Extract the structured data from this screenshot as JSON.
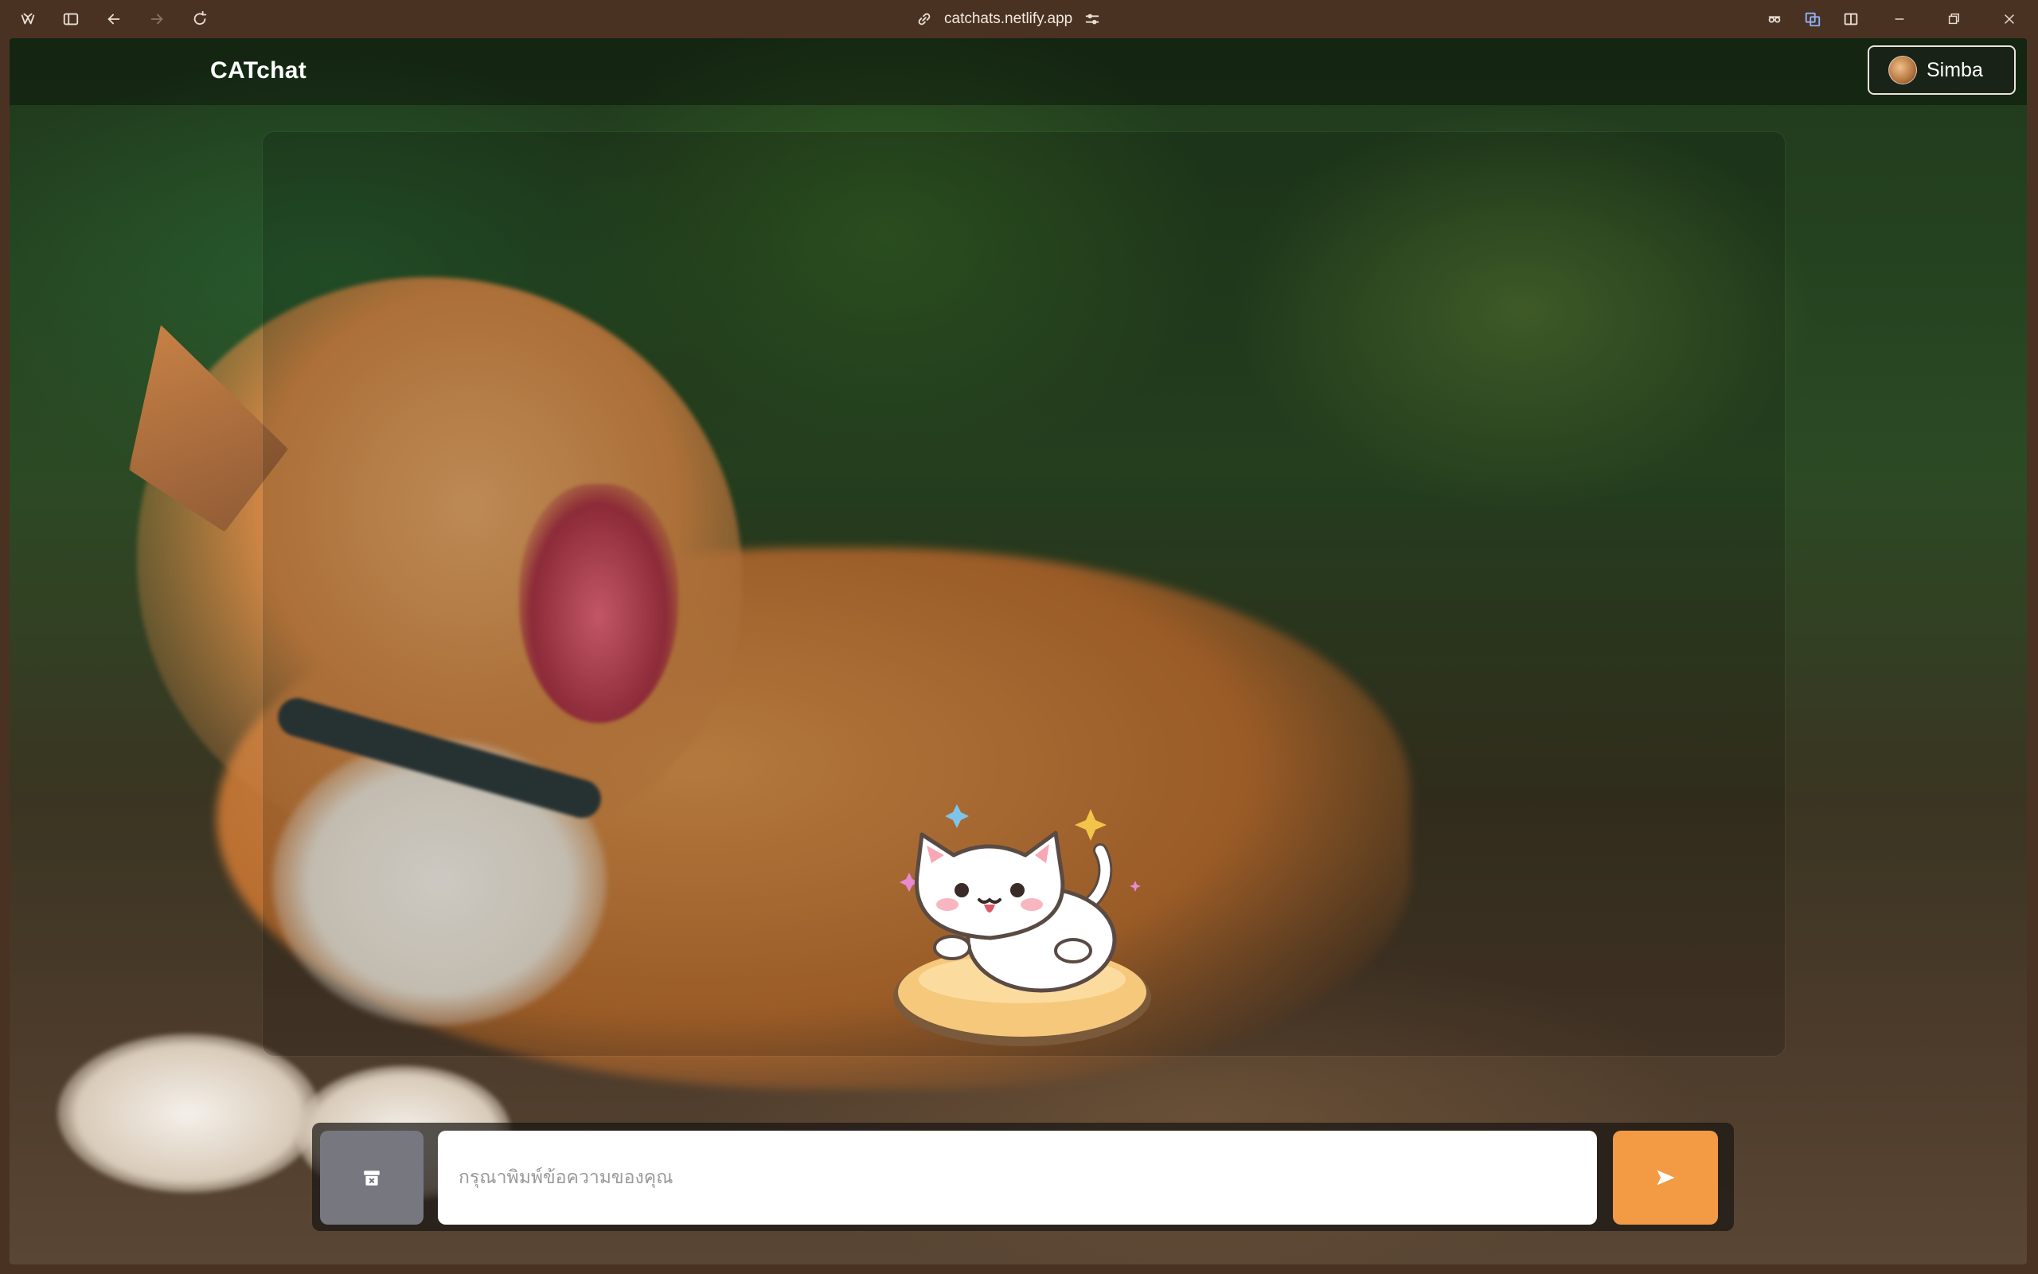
{
  "browser": {
    "url": "catchats.netlify.app",
    "icons": [
      "app-logo-icon",
      "sidebar-toggle-icon",
      "back-arrow-icon",
      "forward-arrow-icon",
      "reload-icon",
      "link-icon",
      "site-settings-icon",
      "extension-icon",
      "translate-icon",
      "split-view-icon",
      "minimize-icon",
      "restore-icon",
      "close-icon"
    ]
  },
  "app": {
    "brand": "CATchat",
    "user": {
      "name": "Simba"
    }
  },
  "composer": {
    "placeholder": "กรุณาพิมพ์ข้อความของคุณ",
    "value": ""
  },
  "colors": {
    "send_button": "#f39a45",
    "clear_button": "#77777f",
    "browser_frame": "#4a3222"
  }
}
